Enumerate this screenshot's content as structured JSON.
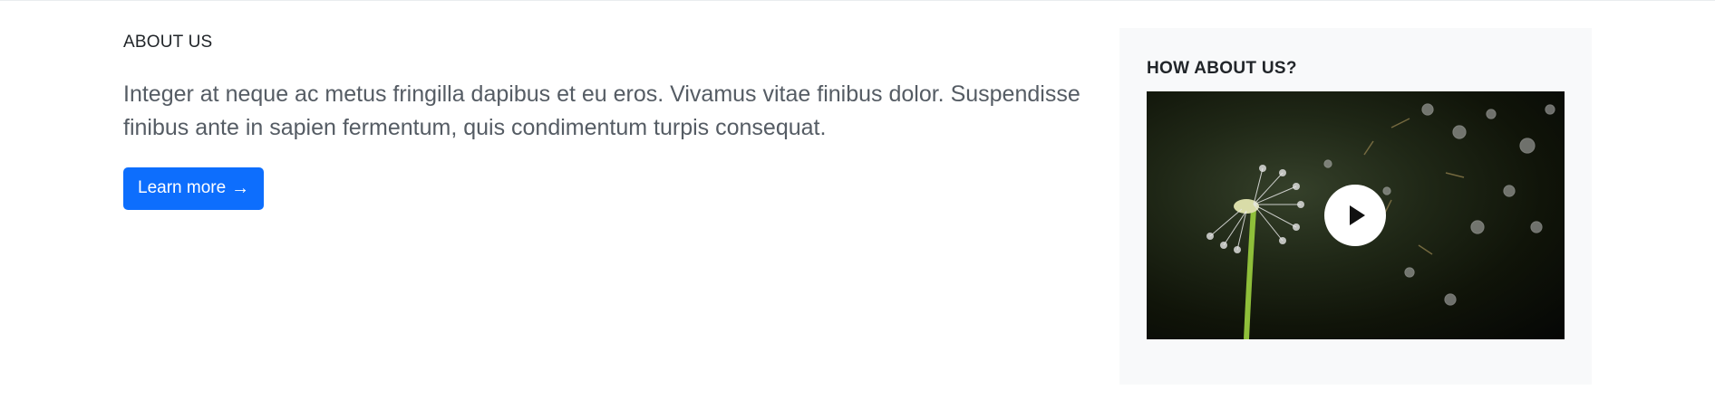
{
  "about": {
    "eyebrow": "ABOUT US",
    "lead": "Integer at neque ac metus fringilla dapibus et eu eros. Vivamus vitae finibus dolor. Suspendisse finibus ante in sapien fermentum, quis condimentum turpis consequat.",
    "button_label": "Learn more",
    "button_icon": "arrow-right-icon",
    "button_arrow": "→"
  },
  "aside": {
    "title": "HOW ABOUT US?",
    "video": {
      "thumbnail_subject": "dandelion-seeds",
      "play_icon": "play-icon"
    }
  },
  "colors": {
    "primary": "#0d6efd",
    "aside_background": "#f8f9fa",
    "lead_text": "#555c64"
  }
}
